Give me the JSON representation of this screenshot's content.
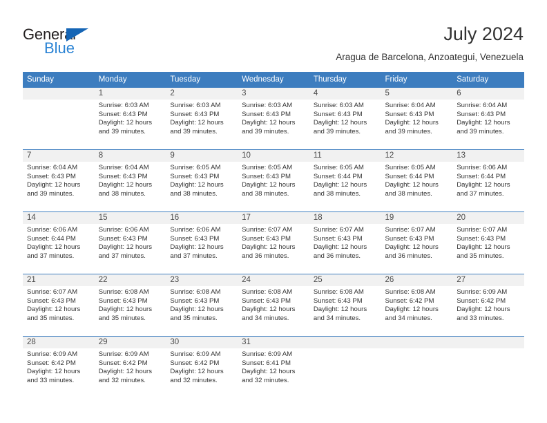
{
  "brand": {
    "name_part1": "General",
    "name_part2": "Blue",
    "accent_color": "#2a83d4",
    "triangle_color": "#1565b5"
  },
  "header": {
    "title": "July 2024",
    "subtitle": "Aragua de Barcelona, Anzoategui, Venezuela"
  },
  "calendar": {
    "header_bg": "#3d7dbf",
    "daynum_band_bg": "#f1f1f1",
    "weekday_headers": [
      "Sunday",
      "Monday",
      "Tuesday",
      "Wednesday",
      "Thursday",
      "Friday",
      "Saturday"
    ],
    "weeks": [
      [
        {
          "day": "",
          "detail": ""
        },
        {
          "day": "1",
          "detail": "Sunrise: 6:03 AM\nSunset: 6:43 PM\nDaylight: 12 hours\nand 39 minutes."
        },
        {
          "day": "2",
          "detail": "Sunrise: 6:03 AM\nSunset: 6:43 PM\nDaylight: 12 hours\nand 39 minutes."
        },
        {
          "day": "3",
          "detail": "Sunrise: 6:03 AM\nSunset: 6:43 PM\nDaylight: 12 hours\nand 39 minutes."
        },
        {
          "day": "4",
          "detail": "Sunrise: 6:03 AM\nSunset: 6:43 PM\nDaylight: 12 hours\nand 39 minutes."
        },
        {
          "day": "5",
          "detail": "Sunrise: 6:04 AM\nSunset: 6:43 PM\nDaylight: 12 hours\nand 39 minutes."
        },
        {
          "day": "6",
          "detail": "Sunrise: 6:04 AM\nSunset: 6:43 PM\nDaylight: 12 hours\nand 39 minutes."
        }
      ],
      [
        {
          "day": "7",
          "detail": "Sunrise: 6:04 AM\nSunset: 6:43 PM\nDaylight: 12 hours\nand 39 minutes."
        },
        {
          "day": "8",
          "detail": "Sunrise: 6:04 AM\nSunset: 6:43 PM\nDaylight: 12 hours\nand 38 minutes."
        },
        {
          "day": "9",
          "detail": "Sunrise: 6:05 AM\nSunset: 6:43 PM\nDaylight: 12 hours\nand 38 minutes."
        },
        {
          "day": "10",
          "detail": "Sunrise: 6:05 AM\nSunset: 6:43 PM\nDaylight: 12 hours\nand 38 minutes."
        },
        {
          "day": "11",
          "detail": "Sunrise: 6:05 AM\nSunset: 6:44 PM\nDaylight: 12 hours\nand 38 minutes."
        },
        {
          "day": "12",
          "detail": "Sunrise: 6:05 AM\nSunset: 6:44 PM\nDaylight: 12 hours\nand 38 minutes."
        },
        {
          "day": "13",
          "detail": "Sunrise: 6:06 AM\nSunset: 6:44 PM\nDaylight: 12 hours\nand 37 minutes."
        }
      ],
      [
        {
          "day": "14",
          "detail": "Sunrise: 6:06 AM\nSunset: 6:44 PM\nDaylight: 12 hours\nand 37 minutes."
        },
        {
          "day": "15",
          "detail": "Sunrise: 6:06 AM\nSunset: 6:43 PM\nDaylight: 12 hours\nand 37 minutes."
        },
        {
          "day": "16",
          "detail": "Sunrise: 6:06 AM\nSunset: 6:43 PM\nDaylight: 12 hours\nand 37 minutes."
        },
        {
          "day": "17",
          "detail": "Sunrise: 6:07 AM\nSunset: 6:43 PM\nDaylight: 12 hours\nand 36 minutes."
        },
        {
          "day": "18",
          "detail": "Sunrise: 6:07 AM\nSunset: 6:43 PM\nDaylight: 12 hours\nand 36 minutes."
        },
        {
          "day": "19",
          "detail": "Sunrise: 6:07 AM\nSunset: 6:43 PM\nDaylight: 12 hours\nand 36 minutes."
        },
        {
          "day": "20",
          "detail": "Sunrise: 6:07 AM\nSunset: 6:43 PM\nDaylight: 12 hours\nand 35 minutes."
        }
      ],
      [
        {
          "day": "21",
          "detail": "Sunrise: 6:07 AM\nSunset: 6:43 PM\nDaylight: 12 hours\nand 35 minutes."
        },
        {
          "day": "22",
          "detail": "Sunrise: 6:08 AM\nSunset: 6:43 PM\nDaylight: 12 hours\nand 35 minutes."
        },
        {
          "day": "23",
          "detail": "Sunrise: 6:08 AM\nSunset: 6:43 PM\nDaylight: 12 hours\nand 35 minutes."
        },
        {
          "day": "24",
          "detail": "Sunrise: 6:08 AM\nSunset: 6:43 PM\nDaylight: 12 hours\nand 34 minutes."
        },
        {
          "day": "25",
          "detail": "Sunrise: 6:08 AM\nSunset: 6:43 PM\nDaylight: 12 hours\nand 34 minutes."
        },
        {
          "day": "26",
          "detail": "Sunrise: 6:08 AM\nSunset: 6:42 PM\nDaylight: 12 hours\nand 34 minutes."
        },
        {
          "day": "27",
          "detail": "Sunrise: 6:09 AM\nSunset: 6:42 PM\nDaylight: 12 hours\nand 33 minutes."
        }
      ],
      [
        {
          "day": "28",
          "detail": "Sunrise: 6:09 AM\nSunset: 6:42 PM\nDaylight: 12 hours\nand 33 minutes."
        },
        {
          "day": "29",
          "detail": "Sunrise: 6:09 AM\nSunset: 6:42 PM\nDaylight: 12 hours\nand 32 minutes."
        },
        {
          "day": "30",
          "detail": "Sunrise: 6:09 AM\nSunset: 6:42 PM\nDaylight: 12 hours\nand 32 minutes."
        },
        {
          "day": "31",
          "detail": "Sunrise: 6:09 AM\nSunset: 6:41 PM\nDaylight: 12 hours\nand 32 minutes."
        },
        {
          "day": "",
          "detail": ""
        },
        {
          "day": "",
          "detail": ""
        },
        {
          "day": "",
          "detail": ""
        }
      ]
    ]
  }
}
